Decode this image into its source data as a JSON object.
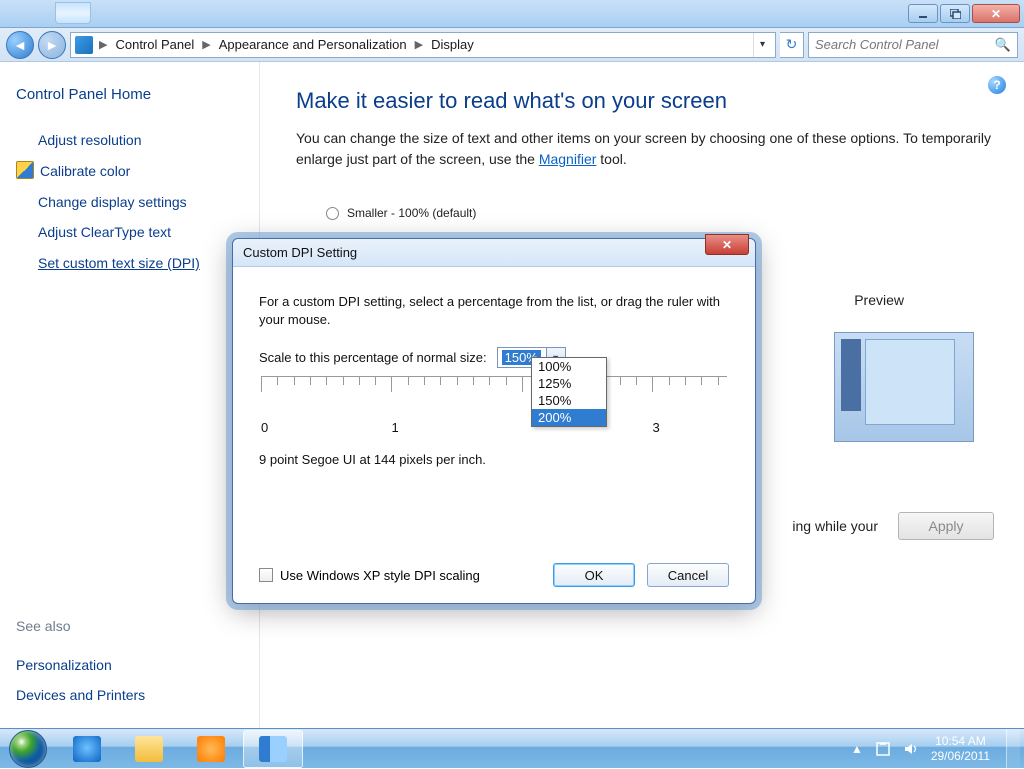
{
  "window": {
    "breadcrumbs": [
      "Control Panel",
      "Appearance and Personalization",
      "Display"
    ],
    "search_placeholder": "Search Control Panel"
  },
  "sidebar": {
    "home": "Control Panel Home",
    "links": [
      "Adjust resolution",
      "Calibrate color",
      "Change display settings",
      "Adjust ClearType text",
      "Set custom text size (DPI)"
    ],
    "see_also_hdr": "See also",
    "see_also": [
      "Personalization",
      "Devices and Printers"
    ]
  },
  "content": {
    "title": "Make it easier to read what's on your screen",
    "body1": "You can change the size of text and other items on your screen by choosing one of these options. To temporarily enlarge just part of the screen, use the ",
    "magnifier": "Magnifier",
    "body2": " tool.",
    "radio_smaller": "Smaller - 100% (default)",
    "preview_label": "Preview",
    "apply_note_tail": "ing while your",
    "apply_btn": "Apply"
  },
  "dialog": {
    "title": "Custom DPI Setting",
    "instr": "For a custom DPI setting, select a percentage from the list, or drag the ruler with your mouse.",
    "scale_label": "Scale to this percentage of normal size:",
    "selected": "150%",
    "options": [
      "100%",
      "125%",
      "150%",
      "200%"
    ],
    "highlighted": "200%",
    "ruler_labels": [
      "0",
      "1",
      "3"
    ],
    "status": "9 point Segoe UI at 144 pixels per inch.",
    "xp_check": "Use Windows XP style DPI scaling",
    "ok": "OK",
    "cancel": "Cancel"
  },
  "taskbar": {
    "time": "10:54 AM",
    "date": "29/06/2011"
  }
}
